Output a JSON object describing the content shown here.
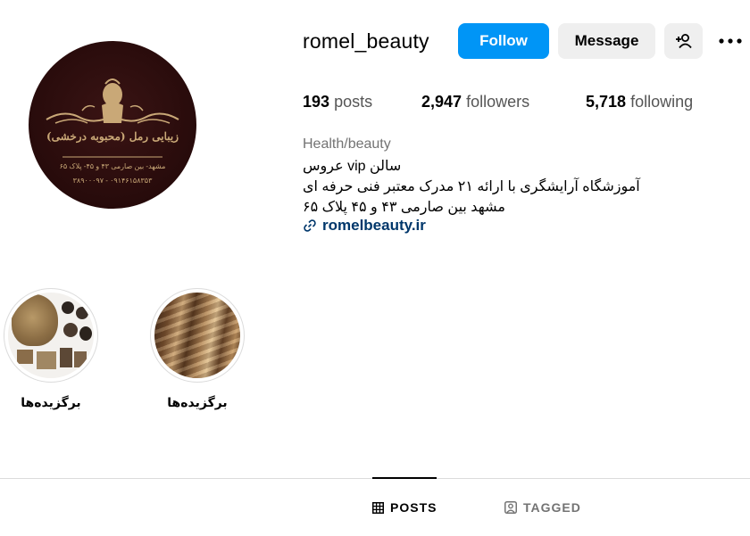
{
  "profile": {
    "username": "romel_beauty",
    "follow_label": "Follow",
    "message_label": "Message",
    "avatar_text": "زیبایی رمل (محبوبه درخشی)",
    "avatar_address": "مشهد- بین صارمی ۴۳ و ۴۵- پلاک ۶۵",
    "avatar_phone": "۰۹۱۴۶۱۵۸۳۵۳ - ۳۸۹۰۰۰۹۷"
  },
  "stats": {
    "posts_count": "193",
    "posts_label": "posts",
    "followers_count": "2,947",
    "followers_label": "followers",
    "following_count": "5,718",
    "following_label": "following"
  },
  "bio": {
    "category": "Health/beauty",
    "line1": "سالن vip عروس",
    "line2": "آموزشگاه آرایشگری با ارائه ۲۱ مدرک معتبر فنی حرفه ای",
    "line3": "مشهد بین صارمی ۴۳ و ۴۵ پلاک ۶۵",
    "link": "romelbeauty.ir"
  },
  "highlights": [
    {
      "label": "برگزیده‌ها"
    },
    {
      "label": "برگزیده‌ها"
    }
  ],
  "tabs": {
    "posts": "POSTS",
    "tagged": "TAGGED"
  },
  "colors": {
    "accent": "#0095f6",
    "link": "#00376b",
    "secondary_text": "#737373",
    "button_bg": "#efefef",
    "avatar_bg": "#2a0c0c",
    "gold": "#c9a877"
  },
  "icons": [
    "add-user-icon",
    "more-options-icon",
    "link-icon",
    "grid-icon",
    "tagged-icon"
  ]
}
